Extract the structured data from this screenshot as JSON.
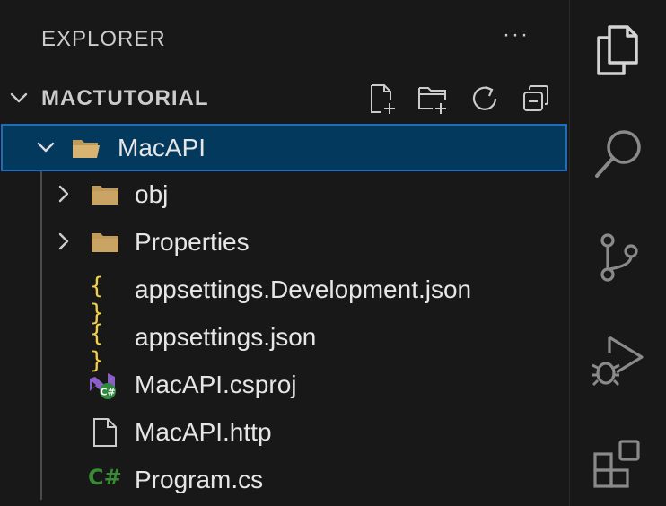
{
  "explorer": {
    "title": "EXPLORER",
    "more_actions": "···"
  },
  "workspace": {
    "name": "MACTUTORIAL",
    "actions": [
      "new-file",
      "new-folder",
      "refresh",
      "collapse-all"
    ]
  },
  "tree": {
    "items": [
      {
        "label": "MacAPI",
        "icon": "folder-open-icon",
        "expanded": true,
        "selected": true
      },
      {
        "label": "obj",
        "icon": "folder-icon",
        "expanded": false
      },
      {
        "label": "Properties",
        "icon": "folder-icon",
        "expanded": false
      },
      {
        "label": "appsettings.Development.json",
        "icon": "json-icon"
      },
      {
        "label": "appsettings.json",
        "icon": "json-icon"
      },
      {
        "label": "MacAPI.csproj",
        "icon": "csproj-icon"
      },
      {
        "label": "MacAPI.http",
        "icon": "file-icon"
      },
      {
        "label": "Program.cs",
        "icon": "csharp-icon"
      }
    ]
  },
  "activity_bar": {
    "items": [
      "explorer-icon",
      "search-icon",
      "source-control-icon",
      "run-debug-icon",
      "extensions-icon"
    ]
  },
  "icons": {
    "json_glyph": "{ }",
    "csharp_glyph": "C#"
  },
  "colors": {
    "background": "#181818",
    "selection": "#04395e",
    "selection_border": "#1f6bbc",
    "folder": "#c09a5a",
    "json": "#f0d04a",
    "csharp": "#388a34",
    "text": "#e6e6e6"
  }
}
